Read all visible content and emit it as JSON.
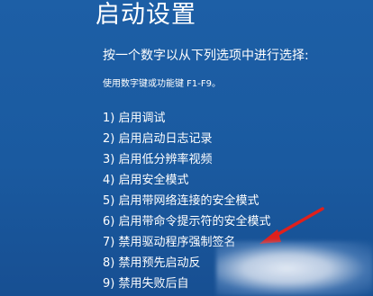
{
  "screen": {
    "title": "启动设置",
    "prompt": "按一个数字以从下列选项中进行选择:",
    "hint": "使用数字键或功能键 F1-F9。"
  },
  "options": [
    {
      "label": "1) 启用调试"
    },
    {
      "label": "2) 启用启动日志记录"
    },
    {
      "label": "3) 启用低分辨率视频"
    },
    {
      "label": "4) 启用安全模式"
    },
    {
      "label": "5) 启用带网络连接的安全模式"
    },
    {
      "label": "6) 启用带命令提示符的安全模式"
    },
    {
      "label": "7) 禁用驱动程序强制签名"
    },
    {
      "label": "8) 禁用预先启动反"
    },
    {
      "label": "9) 禁用失败后自"
    }
  ],
  "colors": {
    "background": "#1a5a9f",
    "text": "#ffffff",
    "annotation_arrow": "#e0201c"
  },
  "icons": {
    "annotation": "red-arrow-icon"
  }
}
